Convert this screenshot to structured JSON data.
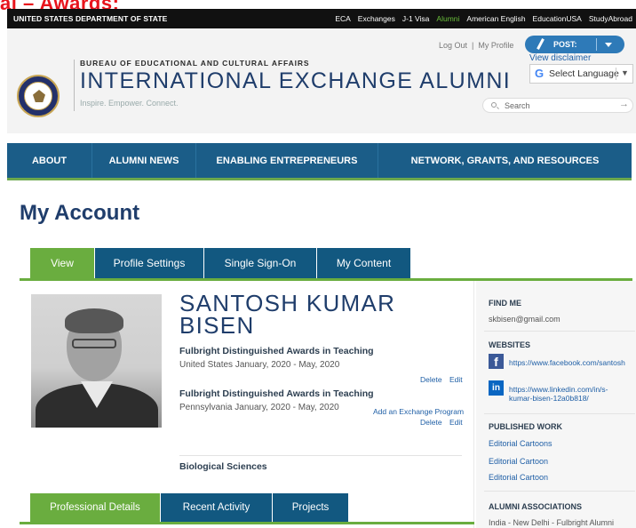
{
  "clipped_heading": "al – Awards:",
  "topbar": {
    "dept": "UNITED STATES DEPARTMENT OF STATE",
    "links": [
      "ECA",
      "Exchanges",
      "J-1 Visa",
      "Alumni",
      "American English",
      "EducationUSA",
      "StudyAbroad"
    ],
    "active": "Alumni",
    "active_color": "#6abf3b"
  },
  "header": {
    "bureau": "BUREAU OF EDUCATIONAL AND CULTURAL AFFAIRS",
    "title": "INTERNATIONAL EXCHANGE ALUMNI",
    "tagline": "Inspire. Empower. Connect.",
    "logout": "Log Out",
    "sep": "|",
    "my_profile": "My Profile",
    "post_label": "POST:",
    "disclaimer": "View disclaimer",
    "lang_g": "G",
    "lang_label": "Select Language",
    "lang_arrow": "▼",
    "search_placeholder": "Search",
    "search_arrow": "→"
  },
  "nav": {
    "items": [
      "ABOUT",
      "ALUMNI NEWS",
      "ENABLING ENTREPRENEURS",
      "NETWORK, GRANTS, AND RESOURCES"
    ],
    "bg_color": "#1b5d88"
  },
  "page": {
    "title": "My Account"
  },
  "tabs": {
    "items": [
      "View",
      "Profile Settings",
      "Single Sign-On",
      "My Content"
    ],
    "active": "View",
    "active_color": "#6aad3f"
  },
  "profile": {
    "name_line1": "SANTOSH KUMAR",
    "name_line2": "BISEN",
    "awards": [
      {
        "title": "Fulbright Distinguished Awards in Teaching",
        "location_date": "United States January, 2020 - May, 2020",
        "delete": "Delete",
        "edit": "Edit"
      },
      {
        "title": "Fulbright Distinguished Awards in Teaching",
        "location_date": "Pennsylvania January, 2020 - May, 2020",
        "delete": "Delete",
        "edit": "Edit"
      }
    ],
    "add_program": "Add an Exchange Program",
    "field": "Biological Sciences"
  },
  "sub_tabs": {
    "items": [
      "Professional Details",
      "Recent Activity",
      "Projects"
    ],
    "active": "Professional Details"
  },
  "sidebar": {
    "find_me": "FIND ME",
    "email": "skbisen@gmail.com",
    "websites": "WEBSITES",
    "facebook_icon": "f",
    "facebook": "https://www.facebook.com/santosh",
    "linkedin_icon": "in",
    "linkedin_line1": "https://www.linkedin.com/in/s-",
    "linkedin_line2": "kumar-bisen-12a0b818/",
    "published": "PUBLISHED WORK",
    "works": [
      "Editorial Cartoons",
      "Editorial Cartoon",
      "Editorial Cartoon"
    ],
    "associations": "ALUMNI ASSOCIATIONS",
    "association_1": "India - New Delhi - Fulbright Alumni"
  }
}
